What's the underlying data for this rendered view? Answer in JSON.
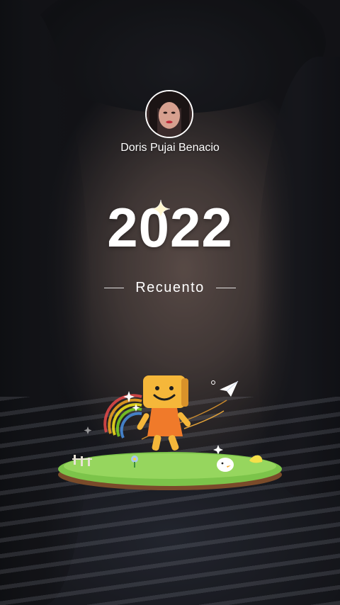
{
  "profile": {
    "name": "Doris Pujai Benacio"
  },
  "recap": {
    "year": "2022",
    "subtitle": "Recuento"
  },
  "colors": {
    "text": "#ffffff",
    "mascot": "#f5b73a",
    "grass": "#7cc44a"
  },
  "icons": {
    "sparkle": "sparkle-icon",
    "paper_plane": "paper-plane-icon"
  }
}
